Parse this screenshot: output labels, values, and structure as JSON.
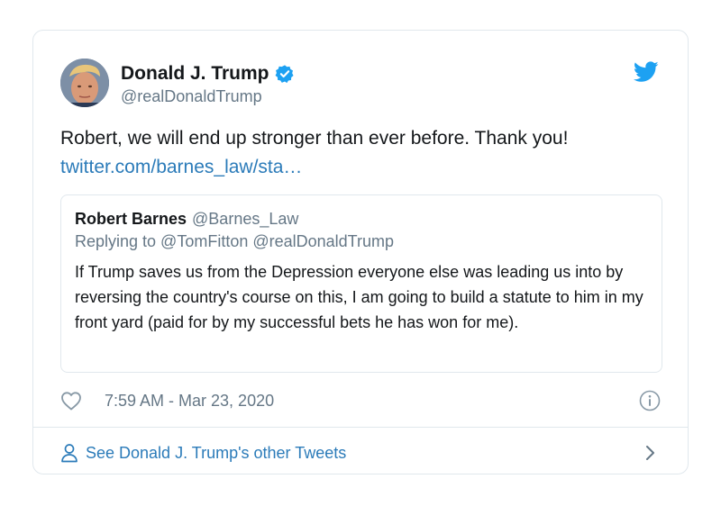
{
  "colors": {
    "brand_blue": "#1da1f2",
    "link_blue": "#2b7bb9",
    "secondary_text": "#657786",
    "border": "#e1e8ed"
  },
  "tweet": {
    "display_name": "Donald J. Trump",
    "handle": "@realDonaldTrump",
    "verified": true,
    "text": "Robert, we will end up stronger than ever before. Thank you!",
    "link": "twitter.com/barnes_law/sta…",
    "timestamp": "7:59 AM - Mar 23, 2020"
  },
  "quoted_tweet": {
    "display_name": "Robert Barnes",
    "handle": "@Barnes_Law",
    "replying_to": "Replying to @TomFitton @realDonaldTrump",
    "text": "If Trump saves us from the Depression everyone else was leading us into by reversing the country's course on this, I am going to build a statute to him in my front yard (paid for by my successful bets he has won for me)."
  },
  "footer": {
    "label": "See Donald J. Trump's other Tweets"
  },
  "icons": {
    "brand": "twitter-bird-icon",
    "verified": "verified-badge-icon",
    "like": "heart-icon",
    "info": "info-icon",
    "profile": "person-icon",
    "more": "chevron-right-icon"
  }
}
